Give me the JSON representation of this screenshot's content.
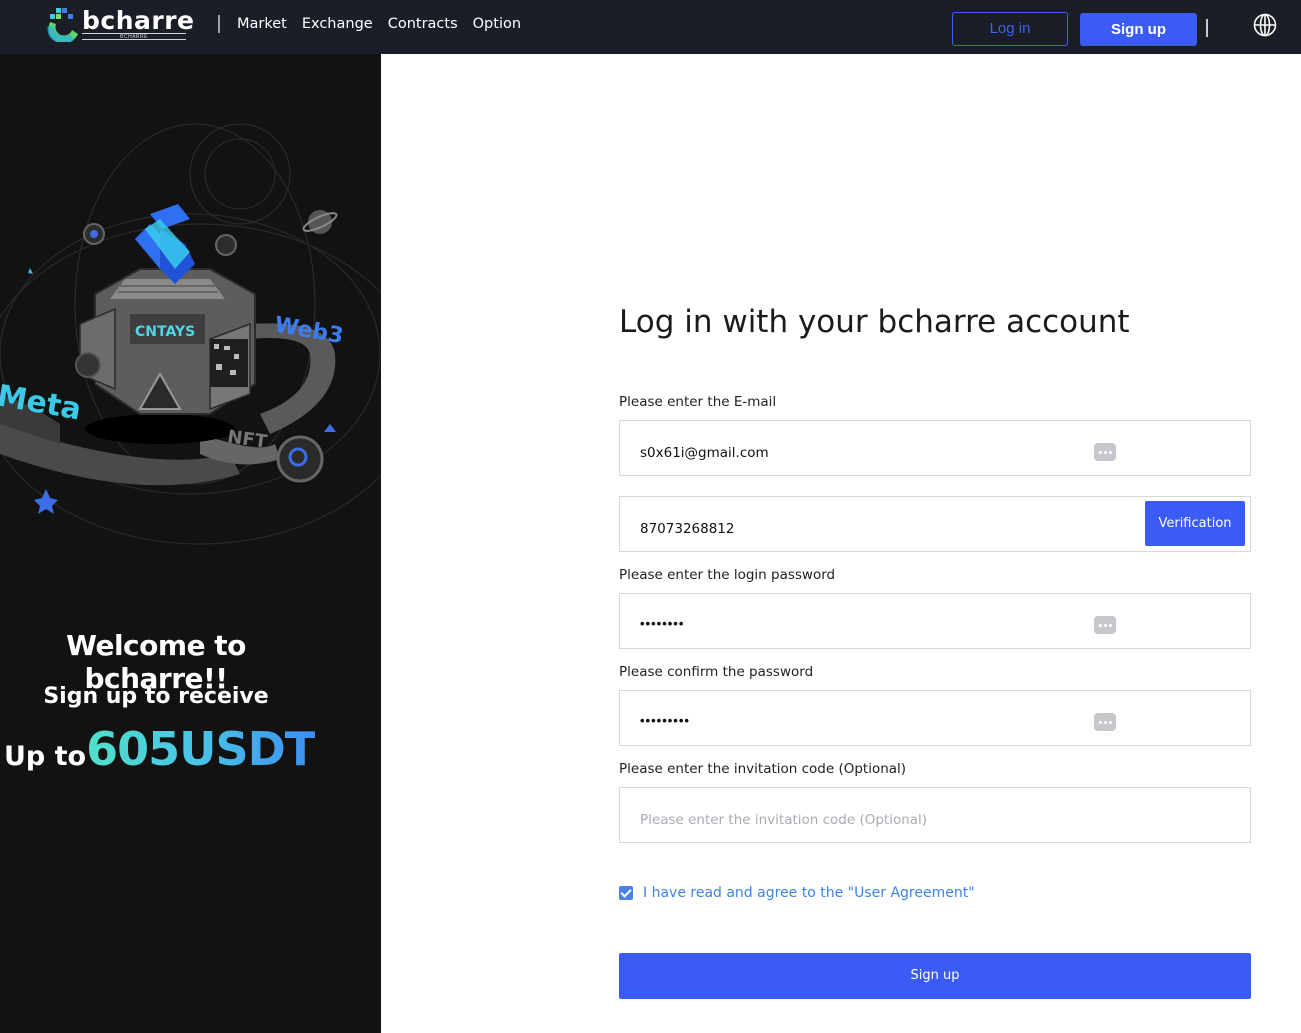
{
  "header": {
    "logo_text": "bcharre",
    "logo_sub": "BCHARRE",
    "nav": [
      "Market",
      "Exchange",
      "Contracts",
      "Option"
    ],
    "login_label": "Log in",
    "signup_label": "Sign up"
  },
  "promo": {
    "badge_web3": "Web3",
    "badge_meta": "Meta",
    "badge_nft": "NFT",
    "badge_brand": "CNTAYS",
    "welcome": "Welcome to bcharre!!",
    "receive": "Sign up to receive",
    "upto_label": "Up to",
    "amount": "605USDT"
  },
  "form": {
    "title": "Log in with your bcharre account",
    "email_label": "Please enter the E-mail",
    "email_value": "s0x61i@gmail.com",
    "code_value": "87073268812",
    "verification_label": "Verification",
    "password_label": "Please enter the login password",
    "password_value": "••••••••",
    "confirm_label": "Please confirm the password",
    "confirm_value": "•••••••••",
    "invite_label": "Please enter the invitation code (Optional)",
    "invite_placeholder": "Please enter the invitation code (Optional)",
    "agree_text": "I have read and agree to the \"User Agreement\"",
    "agree_checked": true,
    "submit_label": "Sign up"
  },
  "colors": {
    "accent": "#3a5cf5",
    "header_bg": "#1b1e27",
    "panel_bg": "#121212",
    "link": "#3f84e5"
  }
}
